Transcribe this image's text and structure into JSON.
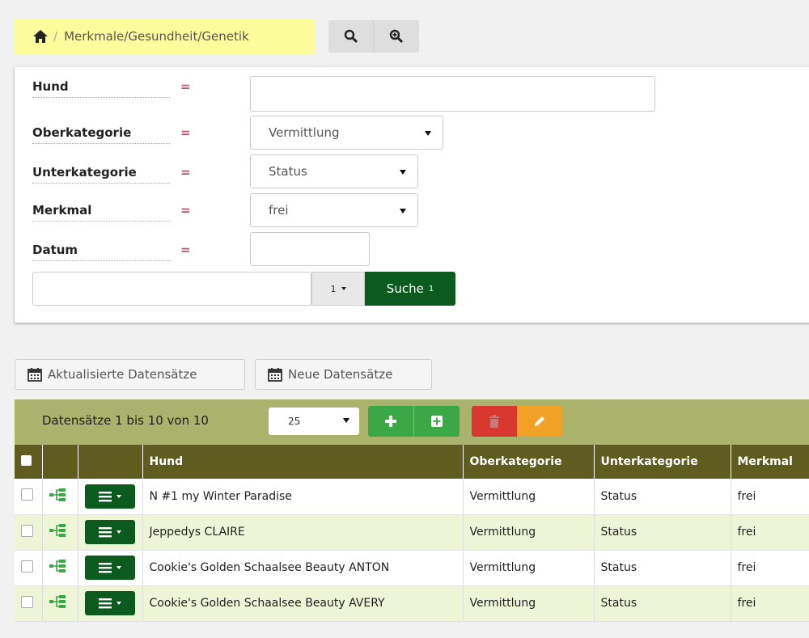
{
  "breadcrumb": {
    "separator": "/",
    "path": "Merkmale/Gesundheit/Genetik"
  },
  "filters": [
    {
      "label": "Hund",
      "operator": "=",
      "value": ""
    },
    {
      "label": "Oberkategorie",
      "operator": "=",
      "value": "Vermittlung"
    },
    {
      "label": "Unterkategorie",
      "operator": "=",
      "value": "Status"
    },
    {
      "label": "Merkmal",
      "operator": "=",
      "value": "frei"
    },
    {
      "label": "Datum",
      "operator": "=",
      "value": ""
    }
  ],
  "search": {
    "value": "",
    "page_count": "1",
    "button_label": "Suche",
    "button_badge": "1"
  },
  "date_buttons": {
    "updated": "Aktualisierte Datensätze",
    "new": "Neue Datensätze"
  },
  "toolbar": {
    "info": "Datensätze 1 bis 10 von 10",
    "per_page": "25"
  },
  "table": {
    "columns": [
      "Hund",
      "Oberkategorie",
      "Unterkategorie",
      "Merkmal"
    ],
    "rows": [
      {
        "hund": "N #1 my Winter Paradise",
        "ober": "Vermittlung",
        "unter": "Status",
        "merkmal": "frei"
      },
      {
        "hund": "Jeppedys CLAIRE",
        "ober": "Vermittlung",
        "unter": "Status",
        "merkmal": "frei"
      },
      {
        "hund": "Cookie's Golden Schaalsee Beauty ANTON",
        "ober": "Vermittlung",
        "unter": "Status",
        "merkmal": "frei"
      },
      {
        "hund": "Cookie's Golden Schaalsee Beauty AVERY",
        "ober": "Vermittlung",
        "unter": "Status",
        "merkmal": "frei"
      }
    ]
  },
  "colors": {
    "header_green": "#5f5c1f",
    "toolbar_green": "#a9b36b",
    "dark_green": "#0b5a1e",
    "row_alt": "#eef4d6"
  }
}
